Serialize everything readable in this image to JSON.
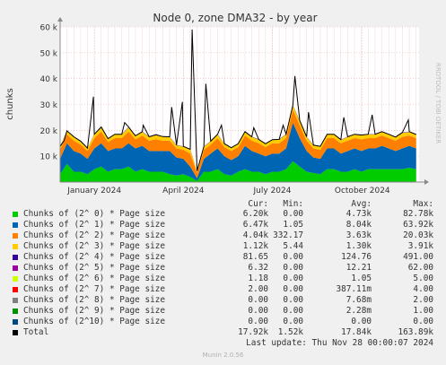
{
  "chart_data": {
    "type": "area",
    "title": "Node 0, zone DMA32 - by year",
    "ylabel": "chunks",
    "watermark": "RRDTOOL / TOBI OETIKER",
    "ylim": [
      0,
      60000
    ],
    "yticks": [
      {
        "value": 10000,
        "label": "10 k"
      },
      {
        "value": 20000,
        "label": "20 k"
      },
      {
        "value": 30000,
        "label": "30 k"
      },
      {
        "value": 40000,
        "label": "40 k"
      },
      {
        "value": 50000,
        "label": "50 k"
      },
      {
        "value": 60000,
        "label": "60 k"
      }
    ],
    "xrange": [
      "2023-11-27",
      "2024-11-28"
    ],
    "xticks": [
      {
        "date": "2024-01-01",
        "label": "January 2024"
      },
      {
        "date": "2024-04-01",
        "label": "April 2024"
      },
      {
        "date": "2024-07-01",
        "label": "July 2024"
      },
      {
        "date": "2024-10-01",
        "label": "October 2024"
      }
    ],
    "x": [
      "2023-11-27",
      "2023-12-04",
      "2023-12-11",
      "2023-12-18",
      "2023-12-25",
      "2024-01-01",
      "2024-01-08",
      "2024-01-15",
      "2024-01-22",
      "2024-01-29",
      "2024-02-05",
      "2024-02-12",
      "2024-02-19",
      "2024-02-26",
      "2024-03-04",
      "2024-03-11",
      "2024-03-18",
      "2024-03-25",
      "2024-04-01",
      "2024-04-08",
      "2024-04-15",
      "2024-04-22",
      "2024-04-29",
      "2024-05-06",
      "2024-05-13",
      "2024-05-20",
      "2024-05-27",
      "2024-06-03",
      "2024-06-10",
      "2024-06-17",
      "2024-06-24",
      "2024-07-01",
      "2024-07-08",
      "2024-07-15",
      "2024-07-22",
      "2024-07-29",
      "2024-08-05",
      "2024-08-12",
      "2024-08-19",
      "2024-08-26",
      "2024-09-02",
      "2024-09-09",
      "2024-09-16",
      "2024-09-23",
      "2024-09-30",
      "2024-10-07",
      "2024-10-14",
      "2024-10-21",
      "2024-10-28",
      "2024-11-04",
      "2024-11-11",
      "2024-11-18",
      "2024-11-25"
    ],
    "series": [
      {
        "name": "Chunks of (2^ 0) * Page size",
        "color": "#00cc00",
        "values": [
          3000,
          7000,
          4000,
          4000,
          3000,
          5000,
          6000,
          4000,
          5000,
          5000,
          6000,
          4000,
          5000,
          4000,
          4000,
          4000,
          3000,
          2500,
          3000,
          2000,
          500,
          4000,
          4000,
          5000,
          3000,
          2500,
          4000,
          5000,
          4000,
          4000,
          3000,
          4000,
          4000,
          5000,
          8000,
          6000,
          4000,
          3500,
          3000,
          5000,
          5000,
          4000,
          4000,
          5000,
          4000,
          5000,
          5000,
          5000,
          5000,
          5000,
          5000,
          5500,
          5000
        ]
      },
      {
        "name": "Chunks of (2^ 1) * Page size",
        "color": "#0066b3",
        "values": [
          6000,
          8000,
          8000,
          7000,
          6000,
          8000,
          9000,
          8000,
          8000,
          8000,
          9000,
          9000,
          9000,
          8000,
          8000,
          8000,
          9000,
          7000,
          6000,
          4000,
          1000,
          5000,
          7000,
          8000,
          7000,
          6000,
          6000,
          9000,
          8000,
          7000,
          7000,
          7000,
          7000,
          8000,
          15000,
          11000,
          8000,
          6000,
          6000,
          8000,
          8000,
          7000,
          8000,
          8000,
          8000,
          8000,
          8000,
          9000,
          8000,
          7000,
          8000,
          8500,
          8000
        ]
      },
      {
        "name": "Chunks of (2^ 2) * Page size",
        "color": "#ff8000",
        "values": [
          3500,
          3500,
          4000,
          3500,
          3000,
          4000,
          4500,
          3500,
          4000,
          4000,
          4500,
          3500,
          4000,
          4000,
          4500,
          4000,
          4000,
          3500,
          3500,
          5000,
          2000,
          3500,
          3500,
          4000,
          3500,
          3500,
          3500,
          4000,
          4000,
          4000,
          3500,
          4000,
          4000,
          4000,
          5000,
          5000,
          4000,
          3500,
          3500,
          4000,
          4000,
          4000,
          4000,
          4000,
          4500,
          4000,
          4000,
          4000,
          4000,
          4000,
          4500,
          4000,
          4000
        ]
      },
      {
        "name": "Chunks of (2^ 3) * Page size",
        "color": "#ffcc00",
        "values": [
          1200,
          1200,
          1400,
          1200,
          1000,
          1400,
          1600,
          1200,
          1400,
          1400,
          1600,
          1300,
          1400,
          1400,
          1600,
          1500,
          1400,
          1200,
          1200,
          1500,
          700,
          1200,
          1200,
          1400,
          1200,
          1200,
          1200,
          1400,
          1400,
          1400,
          1200,
          1300,
          1400,
          1400,
          1600,
          1600,
          1400,
          1200,
          1200,
          1400,
          1400,
          1300,
          1400,
          1400,
          1500,
          1400,
          1400,
          1400,
          1400,
          1300,
          1500,
          1400,
          1300
        ]
      },
      {
        "name": "Chunks of (2^ 4) * Page size",
        "color": "#330099",
        "values": [
          100,
          120,
          130,
          120,
          100,
          130,
          140,
          120,
          130,
          130,
          140,
          120,
          130,
          130,
          140,
          130,
          130,
          110,
          110,
          150,
          60,
          110,
          110,
          130,
          110,
          110,
          110,
          130,
          130,
          130,
          110,
          120,
          130,
          130,
          150,
          150,
          130,
          110,
          110,
          130,
          130,
          120,
          130,
          130,
          140,
          130,
          130,
          130,
          130,
          120,
          140,
          130,
          120
        ]
      },
      {
        "name": "Chunks of (2^ 5) * Page size",
        "color": "#990099",
        "values": [
          10,
          12,
          14,
          12,
          10,
          14,
          15,
          12,
          14,
          14,
          15,
          12,
          14,
          14,
          15,
          13,
          13,
          11,
          11,
          16,
          6,
          11,
          11,
          13,
          11,
          11,
          11,
          13,
          13,
          13,
          11,
          12,
          13,
          13,
          16,
          16,
          13,
          11,
          11,
          13,
          13,
          12,
          13,
          13,
          14,
          13,
          13,
          13,
          13,
          12,
          14,
          13,
          12
        ]
      },
      {
        "name": "Chunks of (2^ 6) * Page size",
        "color": "#ccff00",
        "values": [
          1,
          1,
          1,
          1,
          1,
          1,
          2,
          1,
          1,
          1,
          2,
          1,
          1,
          1,
          2,
          1,
          1,
          1,
          1,
          2,
          1,
          1,
          1,
          1,
          1,
          1,
          1,
          1,
          1,
          1,
          1,
          1,
          1,
          1,
          2,
          2,
          1,
          1,
          1,
          1,
          1,
          1,
          1,
          1,
          1,
          1,
          1,
          1,
          1,
          1,
          1,
          1,
          1
        ]
      },
      {
        "name": "Chunks of (2^ 7) * Page size",
        "color": "#ff0000",
        "values": [
          0,
          0,
          0,
          0,
          0,
          0,
          0,
          0,
          0,
          0,
          0,
          0,
          0,
          0,
          0,
          0,
          0,
          0,
          0,
          0,
          0,
          0,
          0,
          0,
          0,
          0,
          0,
          0,
          0,
          0,
          0,
          0,
          0,
          0,
          0,
          0,
          0,
          0,
          0,
          0,
          0,
          0,
          0,
          0,
          0,
          0,
          0,
          0,
          0,
          0,
          0,
          0,
          0
        ]
      },
      {
        "name": "Chunks of (2^ 8) * Page size",
        "color": "#808080",
        "values": [
          0,
          0,
          0,
          0,
          0,
          0,
          0,
          0,
          0,
          0,
          0,
          0,
          0,
          0,
          0,
          0,
          0,
          0,
          0,
          0,
          0,
          0,
          0,
          0,
          0,
          0,
          0,
          0,
          0,
          0,
          0,
          0,
          0,
          0,
          0,
          0,
          0,
          0,
          0,
          0,
          0,
          0,
          0,
          0,
          0,
          0,
          0,
          0,
          0,
          0,
          0,
          0,
          0
        ]
      },
      {
        "name": "Chunks of (2^ 9) * Page size",
        "color": "#008f00",
        "values": [
          0,
          0,
          0,
          0,
          0,
          0,
          0,
          0,
          0,
          0,
          0,
          0,
          0,
          0,
          0,
          0,
          0,
          0,
          0,
          0,
          0,
          0,
          0,
          0,
          0,
          0,
          0,
          0,
          0,
          0,
          0,
          0,
          0,
          0,
          0,
          0,
          0,
          0,
          0,
          0,
          0,
          0,
          0,
          0,
          0,
          0,
          0,
          0,
          0,
          0,
          0,
          0,
          0
        ]
      },
      {
        "name": "Chunks of (2^10) * Page size",
        "color": "#00487d",
        "values": [
          0,
          0,
          0,
          0,
          0,
          0,
          0,
          0,
          0,
          0,
          0,
          0,
          0,
          0,
          0,
          0,
          0,
          0,
          0,
          0,
          0,
          0,
          0,
          0,
          0,
          0,
          0,
          0,
          0,
          0,
          0,
          0,
          0,
          0,
          0,
          0,
          0,
          0,
          0,
          0,
          0,
          0,
          0,
          0,
          0,
          0,
          0,
          0,
          0,
          0,
          0,
          0,
          0
        ]
      }
    ],
    "total": {
      "name": "Total",
      "color": "#000000",
      "values": [
        13800,
        19800,
        17500,
        15800,
        13100,
        18500,
        21300,
        16800,
        18500,
        18500,
        21300,
        17900,
        19500,
        17500,
        18300,
        17600,
        17500,
        14300,
        13800,
        12700,
        4300,
        13800,
        15800,
        18500,
        14800,
        13300,
        14800,
        19500,
        17500,
        16500,
        14800,
        16400,
        16500,
        18500,
        29800,
        23800,
        17500,
        14300,
        13800,
        18500,
        18500,
        16400,
        17500,
        18500,
        18200,
        18500,
        18500,
        19500,
        18500,
        17400,
        19200,
        19500,
        18400
      ]
    },
    "spikes": [
      {
        "date": "2023-12-01",
        "total": 16000
      },
      {
        "date": "2023-12-31",
        "total": 33000
      },
      {
        "date": "2024-02-01",
        "total": 23000
      },
      {
        "date": "2024-02-20",
        "total": 22000
      },
      {
        "date": "2024-03-20",
        "total": 29000
      },
      {
        "date": "2024-03-31",
        "total": 31000
      },
      {
        "date": "2024-04-10",
        "total": 59000
      },
      {
        "date": "2024-04-24",
        "total": 38000
      },
      {
        "date": "2024-05-10",
        "total": 22000
      },
      {
        "date": "2024-06-12",
        "total": 21000
      },
      {
        "date": "2024-07-12",
        "total": 22000
      },
      {
        "date": "2024-07-24",
        "total": 41000
      },
      {
        "date": "2024-08-07",
        "total": 27000
      },
      {
        "date": "2024-09-12",
        "total": 25000
      },
      {
        "date": "2024-10-11",
        "total": 26000
      },
      {
        "date": "2024-11-17",
        "total": 24000
      }
    ]
  },
  "legend": {
    "headers": {
      "cur": "Cur:",
      "min": "Min:",
      "avg": "Avg:",
      "max": "Max:"
    },
    "rows": [
      {
        "label": "Chunks of (2^ 0) * Page size",
        "color": "#00cc00",
        "cur": "6.20k",
        "min": "0.00",
        "avg": "4.73k",
        "max": "82.78k"
      },
      {
        "label": "Chunks of (2^ 1) * Page size",
        "color": "#0066b3",
        "cur": "6.47k",
        "min": "1.05",
        "avg": "8.04k",
        "max": "63.92k"
      },
      {
        "label": "Chunks of (2^ 2) * Page size",
        "color": "#ff8000",
        "cur": "4.04k",
        "min": "332.17",
        "avg": "3.63k",
        "max": "20.03k"
      },
      {
        "label": "Chunks of (2^ 3) * Page size",
        "color": "#ffcc00",
        "cur": "1.12k",
        "min": "5.44",
        "avg": "1.30k",
        "max": "3.91k"
      },
      {
        "label": "Chunks of (2^ 4) * Page size",
        "color": "#330099",
        "cur": "81.65",
        "min": "0.00",
        "avg": "124.76",
        "max": "491.00"
      },
      {
        "label": "Chunks of (2^ 5) * Page size",
        "color": "#990099",
        "cur": "6.32",
        "min": "0.00",
        "avg": "12.21",
        "max": "62.00"
      },
      {
        "label": "Chunks of (2^ 6) * Page size",
        "color": "#ccff00",
        "cur": "1.18",
        "min": "0.00",
        "avg": "1.05",
        "max": "5.00"
      },
      {
        "label": "Chunks of (2^ 7) * Page size",
        "color": "#ff0000",
        "cur": "2.00",
        "min": "0.00",
        "avg": "387.11m",
        "max": "4.00"
      },
      {
        "label": "Chunks of (2^ 8) * Page size",
        "color": "#808080",
        "cur": "0.00",
        "min": "0.00",
        "avg": "7.68m",
        "max": "2.00"
      },
      {
        "label": "Chunks of (2^ 9) * Page size",
        "color": "#008f00",
        "cur": "0.00",
        "min": "0.00",
        "avg": "2.28m",
        "max": "1.00"
      },
      {
        "label": "Chunks of (2^10) * Page size",
        "color": "#00487d",
        "cur": "0.00",
        "min": "0.00",
        "avg": "0.00",
        "max": "0.00"
      },
      {
        "label": "Total",
        "color": "#000000",
        "cur": "17.92k",
        "min": "1.52k",
        "avg": "17.84k",
        "max": "163.89k"
      }
    ]
  },
  "footer": {
    "last_update": "Last update: Thu Nov 28 00:00:07 2024",
    "generator": "Munin 2.0.56"
  }
}
